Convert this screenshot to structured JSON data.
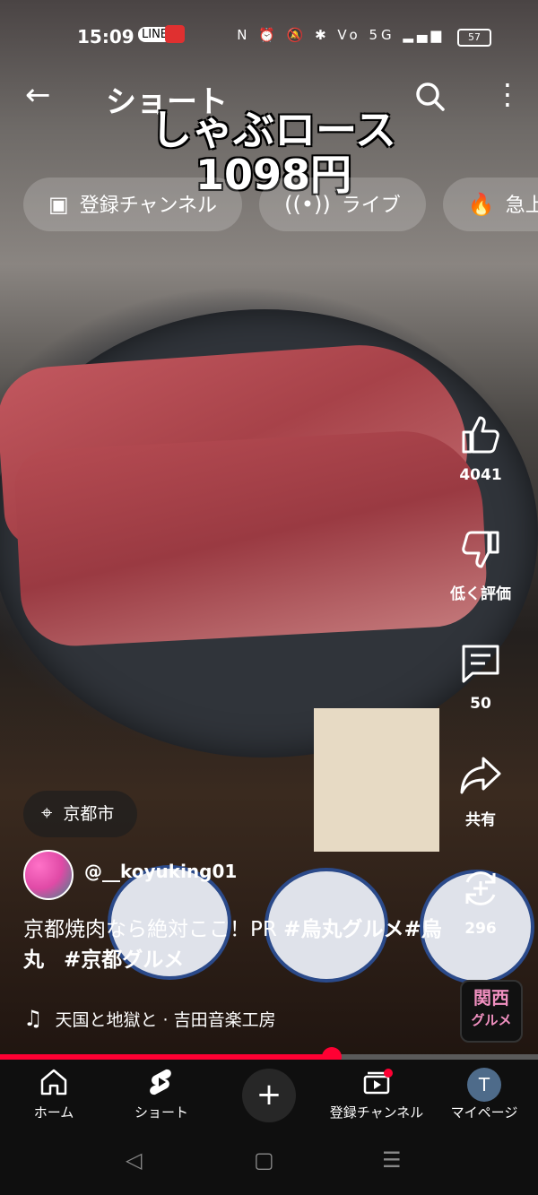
{
  "status_bar": {
    "time": "15:09",
    "icons": "N ⏰ 🔕 ✱ Vo 5G ▂▄▆",
    "battery": "57"
  },
  "header": {
    "title": "ショート",
    "back_icon": "←",
    "more_icon": "⋮"
  },
  "video_overlay": {
    "line1": "しゃぶロース",
    "line2": "1098円"
  },
  "chips": [
    {
      "icon": "subscriptions-icon",
      "label": "登録チャンネル"
    },
    {
      "icon": "live-icon",
      "label": "ライブ"
    },
    {
      "icon": "trending-icon",
      "label": "急上"
    }
  ],
  "actions": {
    "like_count": "4041",
    "dislike_label": "低く評価",
    "comment_count": "50",
    "share_label": "共有",
    "remix_count": "296"
  },
  "location": {
    "label": "京都市"
  },
  "channel": {
    "handle": "@__koyuking01"
  },
  "description": {
    "text": "京都焼肉なら絶対ここ！PR ",
    "tag1": "#烏丸グルメ",
    "tag2": "#烏丸",
    "tag3": "#京都グルメ"
  },
  "music": {
    "label": "天国と地獄と · 吉田音楽工房"
  },
  "brand_badge": {
    "line1": "関西",
    "line2": "グルメ"
  },
  "progress": {
    "fraction": 0.617
  },
  "bottom_nav": [
    {
      "label": "ホーム"
    },
    {
      "label": "ショート"
    },
    {
      "label": "登録チャンネル"
    },
    {
      "label": "マイページ",
      "avatar_letter": "T"
    }
  ],
  "colors": {
    "accent": "#ff0033",
    "nav_bg": "#0f0f0f"
  }
}
